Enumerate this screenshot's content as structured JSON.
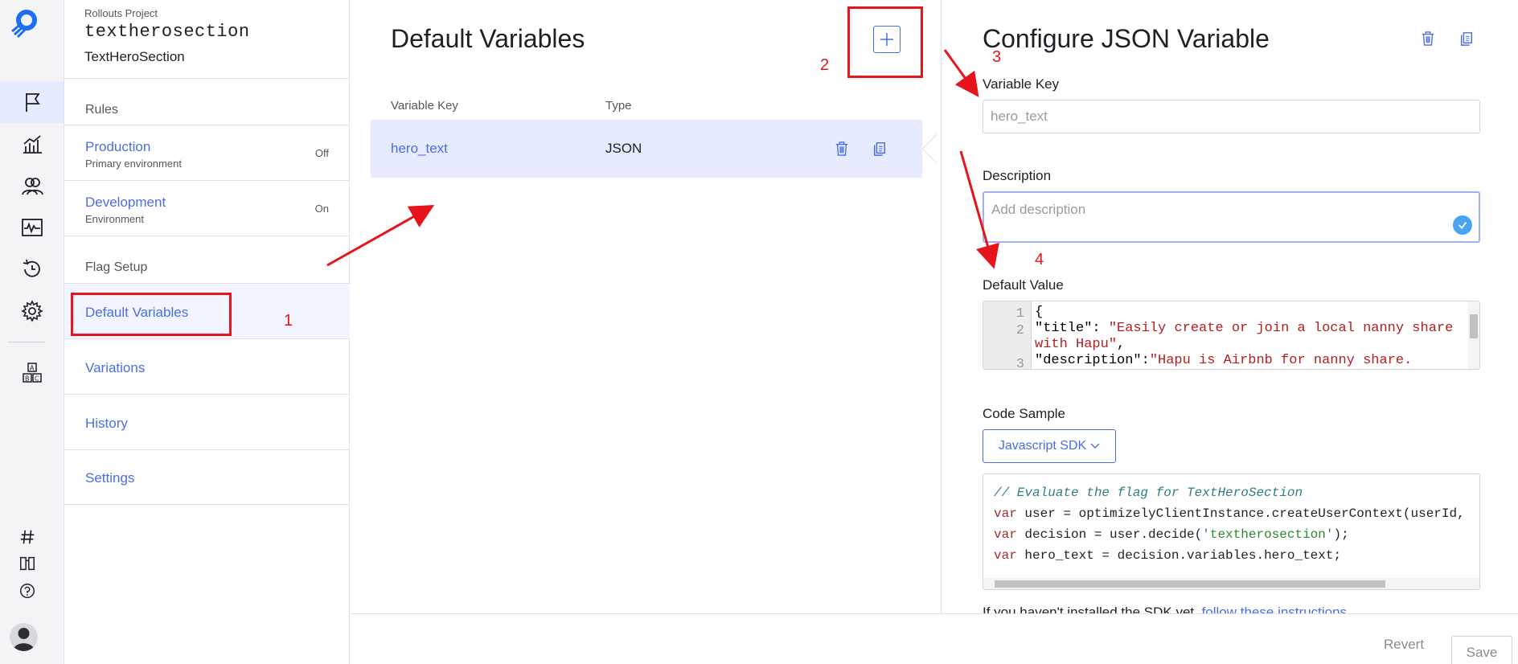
{
  "project": {
    "label": "Rollouts Project",
    "flag_key": "textherosection",
    "flag_name": "TextHeroSection"
  },
  "flagnav": {
    "rules_title": "Rules",
    "environments": [
      {
        "name": "Production",
        "desc": "Primary environment",
        "state": "Off"
      },
      {
        "name": "Development",
        "desc": "Environment",
        "state": "On"
      }
    ],
    "setup_title": "Flag Setup",
    "items": [
      "Default Variables",
      "Variations",
      "History",
      "Settings"
    ]
  },
  "variables": {
    "title": "Default Variables",
    "columns": {
      "key": "Variable Key",
      "type": "Type"
    },
    "rows": [
      {
        "key": "hero_text",
        "type": "JSON"
      }
    ]
  },
  "config": {
    "title": "Configure JSON Variable",
    "key_label": "Variable Key",
    "key_value": "hero_text",
    "description_label": "Description",
    "description_placeholder": "Add description",
    "default_label": "Default Value",
    "code_lines": {
      "l1": "{",
      "l2_key": "\"title\": ",
      "l2_val": "\"Easily create or join a local nanny share with Hapu\"",
      "l2_end": ",",
      "l3_key": "\"description\":",
      "l3_val": "\"Hapu is Airbnb for nanny share."
    },
    "line_numbers": [
      "1",
      "2",
      "3"
    ],
    "sample_label": "Code Sample",
    "sdk_select": "Javascript SDK",
    "sample": {
      "comment": "// Evaluate the flag for TextHeroSection",
      "kw": "var",
      "l2": " user = optimizelyClientInstance.createUserContext(userId,",
      "l3a": " decision = user.decide(",
      "l3s": "'textherosection'",
      "l3b": ");",
      "l4": " hero_text = decision.variables.hero_text;"
    },
    "install_text": "If you haven't installed the SDK yet,",
    "install_link": "follow these instructions"
  },
  "footer": {
    "revert": "Revert",
    "save": "Save"
  },
  "annotations": {
    "n1": "1",
    "n2": "2",
    "n3": "3",
    "n4": "4"
  },
  "colors": {
    "accent": "#4a6ee0",
    "annotation": "#e8141c",
    "selected_row": "#e6ebff"
  }
}
